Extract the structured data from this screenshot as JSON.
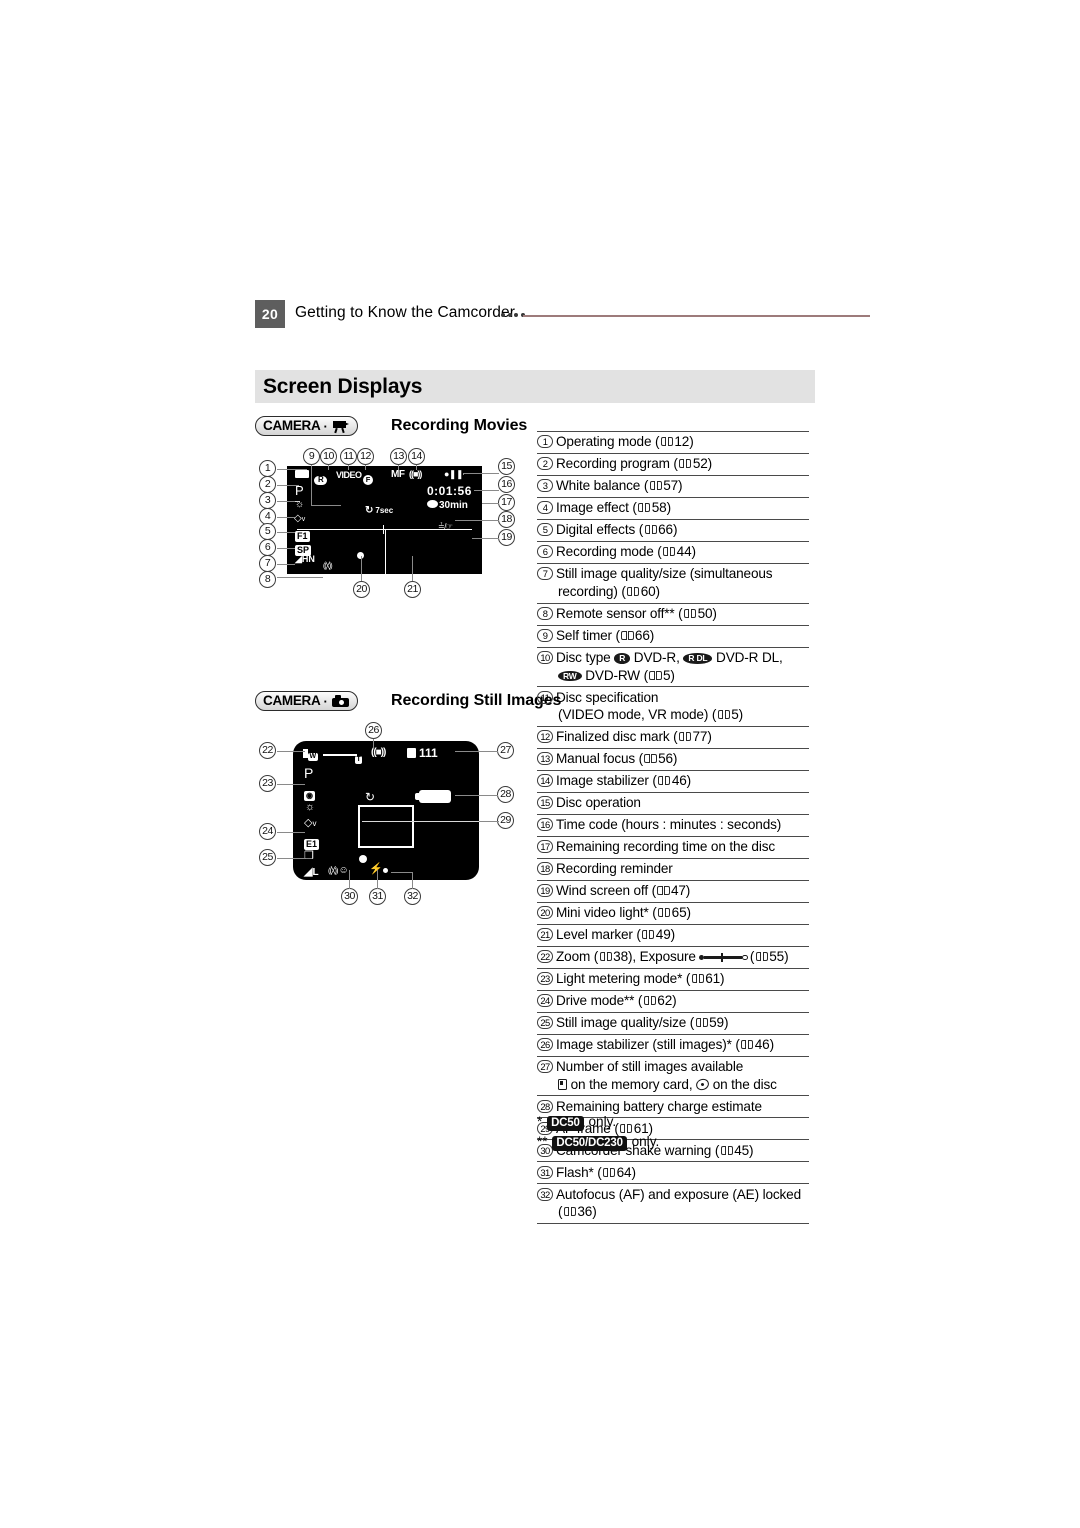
{
  "header": {
    "page_number": "20",
    "title": "Getting to Know the Camcorder",
    "dots": "••••"
  },
  "section": {
    "title": "Screen Displays"
  },
  "diagrams": [
    {
      "badge_text": "CAMERA",
      "badge_dot": "·",
      "badge_icon": "movie-camera-icon",
      "title": "Recording Movies",
      "osd": {
        "operating_mode": "recording-movie-icon",
        "recording_program": "P",
        "white_balance": "white-balance-icon",
        "image_effect": "image-effect-icon",
        "digital_effects": "F1",
        "recording_mode": "SP",
        "still_quality": "still-quality-icon",
        "remote_sensor_off": "remote-sensor-off-icon",
        "disc_type": "R",
        "disc_spec": "VIDEO",
        "finalized_mark": "F",
        "manual_focus": "MF",
        "image_stabilizer": "stabilizer-icon",
        "disc_operation": "record-pause-icon",
        "time_code": "0:01:56",
        "remaining_time": "30min",
        "self_timer": "7sec",
        "wind_screen_off": "wind-screen-off-icon"
      },
      "callouts": [
        "1",
        "2",
        "3",
        "4",
        "5",
        "6",
        "7",
        "8",
        "9",
        "10",
        "11",
        "12",
        "13",
        "14",
        "15",
        "16",
        "17",
        "18",
        "19",
        "20",
        "21"
      ]
    },
    {
      "badge_text": "CAMERA",
      "badge_dot": "·",
      "badge_icon": "still-camera-icon",
      "title": "Recording Still Images",
      "osd": {
        "zoom_w": "W",
        "zoom_t": "T",
        "recording_program": "P",
        "light_metering": "metering-icon",
        "white_balance": "white-balance-icon",
        "image_effect": "image-effect-icon",
        "digital_effects": "E1",
        "drive_mode": "drive-mode-icon",
        "still_quality": "L",
        "image_stabilizer": "stabilizer-icon",
        "images_available": "111",
        "self_timer": "self-timer-icon",
        "battery": "battery-icon",
        "af_frame": "af-frame",
        "shake_warning": "shake-warning-icon",
        "flash": "flash-icon",
        "af_ae_locked": "af-ae-lock-dot"
      },
      "callouts": [
        "22",
        "23",
        "24",
        "25",
        "26",
        "27",
        "28",
        "29",
        "30",
        "31",
        "32"
      ]
    }
  ],
  "legend": [
    {
      "num": "1",
      "text": "Operating mode (",
      "page": "12",
      "tail": ")"
    },
    {
      "num": "2",
      "text": "Recording program (",
      "page": "52",
      "tail": ")"
    },
    {
      "num": "3",
      "text": "White balance (",
      "page": "57",
      "tail": ")"
    },
    {
      "num": "4",
      "text": "Image effect (",
      "page": "58",
      "tail": ")"
    },
    {
      "num": "5",
      "text": "Digital effects (",
      "page": "66",
      "tail": ")"
    },
    {
      "num": "6",
      "text": "Recording mode (",
      "page": "44",
      "tail": ")"
    },
    {
      "num": "7",
      "text": "Still image quality/size (simultaneous",
      "cont_pre": "recording) (",
      "page": "60",
      "tail": ")"
    },
    {
      "num": "8",
      "text": "Remote sensor off** (",
      "page": "50",
      "tail": ")"
    },
    {
      "num": "9",
      "text": "Self timer (",
      "page": "66",
      "tail": ")"
    },
    {
      "num": "10",
      "text": "Disc type",
      "disc_line": true,
      "disc1": "R",
      "disc1_label": "DVD-R,",
      "disc2": "R DL",
      "disc2_label": "DVD-R DL,",
      "cont_disc": "RW",
      "cont_disc_label": "DVD-RW (",
      "page": "5",
      "tail": ")"
    },
    {
      "num": "11",
      "text": "Disc specification",
      "cont_pre": "(VIDEO mode, VR mode) (",
      "page": "5",
      "tail": ")"
    },
    {
      "num": "12",
      "text": "Finalized disc mark (",
      "page": "77",
      "tail": ")"
    },
    {
      "num": "13",
      "text": "Manual focus (",
      "page": "56",
      "tail": ")"
    },
    {
      "num": "14",
      "text": "Image stabilizer (",
      "page": "46",
      "tail": ")"
    },
    {
      "num": "15",
      "text": "Disc operation"
    },
    {
      "num": "16",
      "text": "Time code (hours : minutes : seconds)"
    },
    {
      "num": "17",
      "text": "Remaining recording time on the disc"
    },
    {
      "num": "18",
      "text": "Recording reminder"
    },
    {
      "num": "19",
      "text": "Wind screen off (",
      "page": "47",
      "tail": ")"
    },
    {
      "num": "20",
      "text": "Mini video light* (",
      "page": "65",
      "tail": ")"
    },
    {
      "num": "21",
      "text": "Level marker (",
      "page": "49",
      "tail": ")"
    },
    {
      "num": "22",
      "text": "Zoom (",
      "page": "38",
      "mid": "), Exposure",
      "slider": true,
      "page2": "55",
      "tail": ")"
    },
    {
      "num": "23",
      "text": "Light metering mode* (",
      "page": "61",
      "tail": ")"
    },
    {
      "num": "24",
      "text": "Drive mode** (",
      "page": "62",
      "tail": ")"
    },
    {
      "num": "25",
      "text": "Still image quality/size (",
      "page": "59",
      "tail": ")"
    },
    {
      "num": "26",
      "text": "Image stabilizer (still images)* (",
      "page": "46",
      "tail": ")"
    },
    {
      "num": "27",
      "text": "Number of still images available",
      "cont_card": "on the memory card,",
      "cont_disc2": "on the disc"
    },
    {
      "num": "28",
      "text": "Remaining battery charge estimate"
    },
    {
      "num": "29",
      "text": "AF frame (",
      "page": "61",
      "tail": ")"
    },
    {
      "num": "30",
      "text": "Camcorder shake warning (",
      "page": "45",
      "tail": ")"
    },
    {
      "num": "31",
      "text": "Flash* (",
      "page": "64",
      "tail": ")"
    },
    {
      "num": "32",
      "text": "Autofocus (AF) and exposure (AE) locked",
      "cont_pre": "(",
      "page": "36",
      "tail": ")"
    }
  ],
  "footnotes": [
    {
      "marker": "*",
      "badge": "DC50",
      "text": "only."
    },
    {
      "marker": "**",
      "badge": "DC50/DC230",
      "text": "only."
    }
  ]
}
